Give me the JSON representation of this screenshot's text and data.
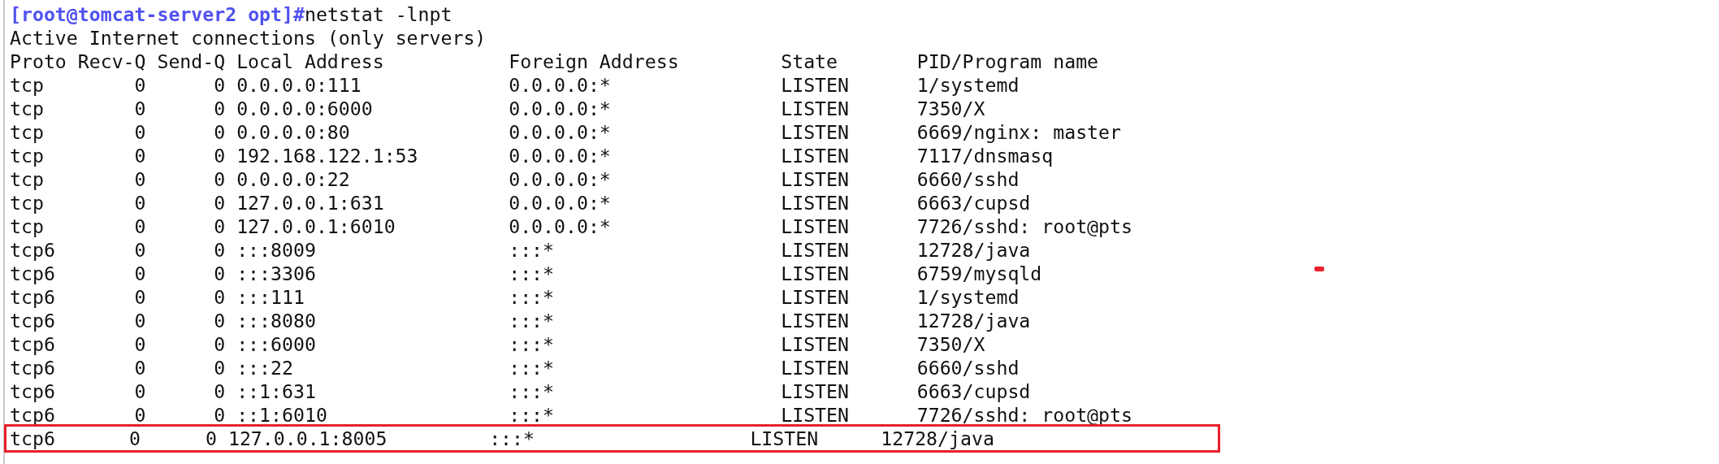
{
  "prompt": {
    "user_host": "[root@tomcat-server2 opt]#",
    "command": "netstat -lnpt"
  },
  "summary": "Active Internet connections (only servers)",
  "columns": [
    "Proto",
    "Recv-Q",
    "Send-Q",
    "Local Address",
    "Foreign Address",
    "State",
    "PID/Program name"
  ],
  "rows": [
    {
      "proto": "tcp",
      "recv_q": "0",
      "send_q": "0",
      "local": "0.0.0.0:111",
      "foreign": "0.0.0.0:*",
      "state": "LISTEN",
      "program": "1/systemd",
      "highlighted": false
    },
    {
      "proto": "tcp",
      "recv_q": "0",
      "send_q": "0",
      "local": "0.0.0.0:6000",
      "foreign": "0.0.0.0:*",
      "state": "LISTEN",
      "program": "7350/X",
      "highlighted": false
    },
    {
      "proto": "tcp",
      "recv_q": "0",
      "send_q": "0",
      "local": "0.0.0.0:80",
      "foreign": "0.0.0.0:*",
      "state": "LISTEN",
      "program": "6669/nginx: master",
      "highlighted": false
    },
    {
      "proto": "tcp",
      "recv_q": "0",
      "send_q": "0",
      "local": "192.168.122.1:53",
      "foreign": "0.0.0.0:*",
      "state": "LISTEN",
      "program": "7117/dnsmasq",
      "highlighted": false
    },
    {
      "proto": "tcp",
      "recv_q": "0",
      "send_q": "0",
      "local": "0.0.0.0:22",
      "foreign": "0.0.0.0:*",
      "state": "LISTEN",
      "program": "6660/sshd",
      "highlighted": false
    },
    {
      "proto": "tcp",
      "recv_q": "0",
      "send_q": "0",
      "local": "127.0.0.1:631",
      "foreign": "0.0.0.0:*",
      "state": "LISTEN",
      "program": "6663/cupsd",
      "highlighted": false
    },
    {
      "proto": "tcp",
      "recv_q": "0",
      "send_q": "0",
      "local": "127.0.0.1:6010",
      "foreign": "0.0.0.0:*",
      "state": "LISTEN",
      "program": "7726/sshd: root@pts",
      "highlighted": false
    },
    {
      "proto": "tcp6",
      "recv_q": "0",
      "send_q": "0",
      "local": ":::8009",
      "foreign": ":::*",
      "state": "LISTEN",
      "program": "12728/java",
      "highlighted": false
    },
    {
      "proto": "tcp6",
      "recv_q": "0",
      "send_q": "0",
      "local": ":::3306",
      "foreign": ":::*",
      "state": "LISTEN",
      "program": "6759/mysqld",
      "highlighted": false
    },
    {
      "proto": "tcp6",
      "recv_q": "0",
      "send_q": "0",
      "local": ":::111",
      "foreign": ":::*",
      "state": "LISTEN",
      "program": "1/systemd",
      "highlighted": false
    },
    {
      "proto": "tcp6",
      "recv_q": "0",
      "send_q": "0",
      "local": ":::8080",
      "foreign": ":::*",
      "state": "LISTEN",
      "program": "12728/java",
      "highlighted": false
    },
    {
      "proto": "tcp6",
      "recv_q": "0",
      "send_q": "0",
      "local": ":::6000",
      "foreign": ":::*",
      "state": "LISTEN",
      "program": "7350/X",
      "highlighted": false
    },
    {
      "proto": "tcp6",
      "recv_q": "0",
      "send_q": "0",
      "local": ":::22",
      "foreign": ":::*",
      "state": "LISTEN",
      "program": "6660/sshd",
      "highlighted": false
    },
    {
      "proto": "tcp6",
      "recv_q": "0",
      "send_q": "0",
      "local": "::1:631",
      "foreign": ":::*",
      "state": "LISTEN",
      "program": "6663/cupsd",
      "highlighted": false
    },
    {
      "proto": "tcp6",
      "recv_q": "0",
      "send_q": "0",
      "local": "::1:6010",
      "foreign": ":::*",
      "state": "LISTEN",
      "program": "7726/sshd: root@pts",
      "highlighted": false
    },
    {
      "proto": "tcp6",
      "recv_q": "0",
      "send_q": "0",
      "local": "127.0.0.1:8005",
      "foreign": ":::*",
      "state": "LISTEN",
      "program": "12728/java",
      "highlighted": true
    }
  ]
}
